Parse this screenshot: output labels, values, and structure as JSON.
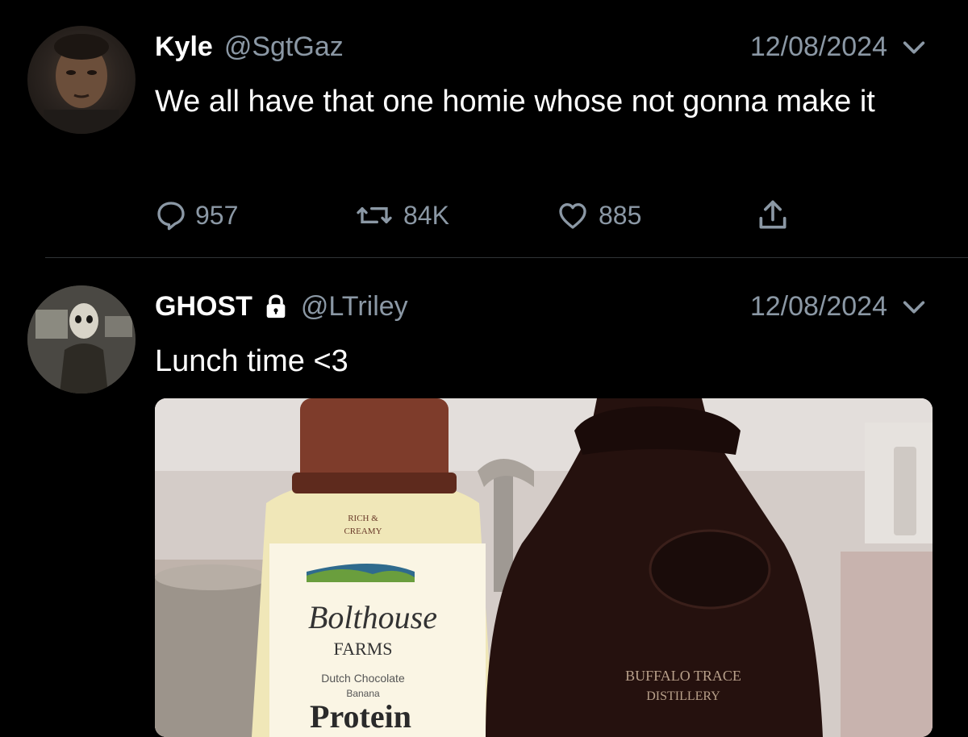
{
  "tweets": [
    {
      "name": "Kyle",
      "handle": "@SgtGaz",
      "date": "12/08/2024",
      "text": "We all have that one homie whose not gonna make it",
      "actions": {
        "replies": "957",
        "retweets": "84K",
        "likes": "885"
      }
    },
    {
      "name": "GHOST",
      "handle": "@LTriley",
      "date": "12/08/2024",
      "text": "Lunch time <3",
      "media": {
        "label_bottle_1": [
          "RICH &",
          "CREAMY"
        ],
        "brand_1": "Bolthouse",
        "brand_1_line2": "FARMS",
        "flavor_1": "Dutch Chocolate",
        "flavor_1_line2": "Banana",
        "product_1": "Protein",
        "label_bottle_2": "BUFFALO TRACE",
        "label_bottle_2_line2": "DISTILLERY"
      }
    }
  ],
  "colors": {
    "background": "#000000",
    "muted": "#8b98a5",
    "divider": "#2f3336"
  }
}
